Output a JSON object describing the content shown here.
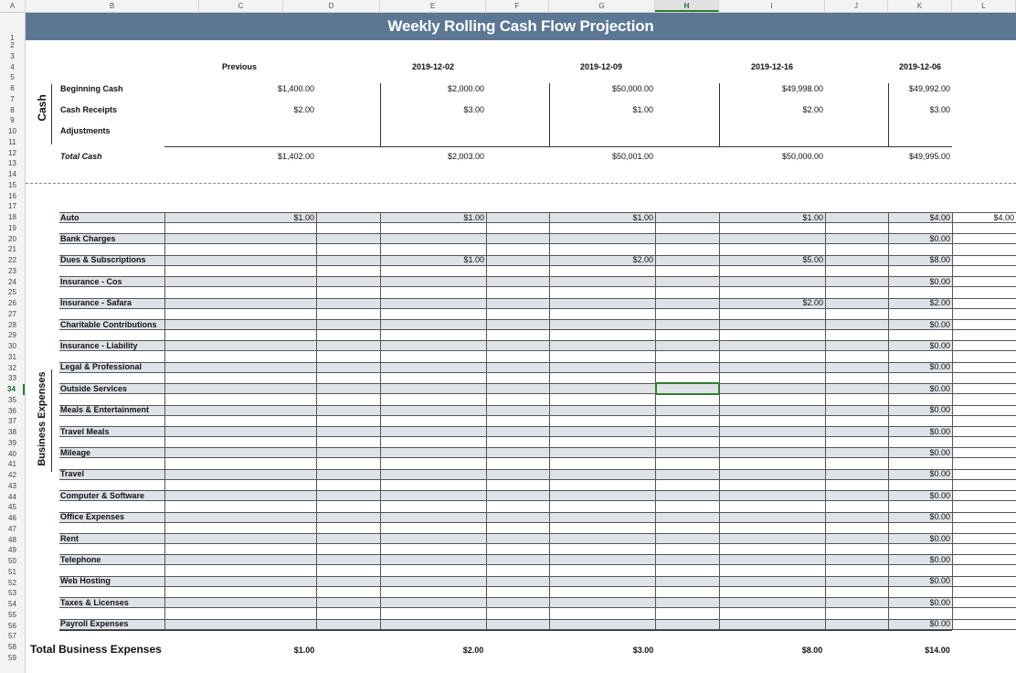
{
  "columns": [
    "A",
    "B",
    "C",
    "D",
    "E",
    "F",
    "G",
    "H",
    "I",
    "J",
    "K",
    "L"
  ],
  "selected_column": "H",
  "selected_row": "34",
  "title": "Weekly Rolling Cash Flow Projection",
  "period_headers": [
    "Previous",
    "2019-12-02",
    "2019-12-09",
    "2019-12-16",
    "2019-12-06"
  ],
  "cash_section_label": "Cash",
  "cash_rows": [
    {
      "label": "Beginning Cash",
      "values": [
        "$1,400.00",
        "$2,000.00",
        "$50,000.00",
        "$49,998.00",
        "$49,992.00"
      ]
    },
    {
      "label": "Cash Receipts",
      "values": [
        "$2.00",
        "$3.00",
        "$1.00",
        "$2.00",
        "$3.00"
      ]
    },
    {
      "label": "Adjustments",
      "values": [
        "",
        "",
        "",
        "",
        ""
      ]
    }
  ],
  "total_cash": {
    "label": "Total Cash",
    "values": [
      "$1,402.00",
      "$2,003.00",
      "$50,001.00",
      "$50,000.00",
      "$49,995.00"
    ]
  },
  "expenses_section_label": "Business Expenses",
  "expense_rows": [
    {
      "label": "Auto",
      "values": [
        "$1.00",
        "$1.00",
        "$1.00",
        "$1.00"
      ],
      "total": "$4.00",
      "extra": "$4.00"
    },
    {
      "label": "Bank Charges",
      "values": [
        "",
        "",
        "",
        ""
      ],
      "total": "$0.00",
      "extra": ""
    },
    {
      "label": "Dues & Subscriptions",
      "values": [
        "",
        "$1.00",
        "$2.00",
        "$5.00"
      ],
      "total": "$8.00",
      "extra": ""
    },
    {
      "label": "Insurance - Cos",
      "values": [
        "",
        "",
        "",
        ""
      ],
      "total": "$0.00",
      "extra": ""
    },
    {
      "label": "Insurance - Safara",
      "values": [
        "",
        "",
        "",
        "$2.00"
      ],
      "total": "$2.00",
      "extra": ""
    },
    {
      "label": "Charitable Contributions",
      "values": [
        "",
        "",
        "",
        ""
      ],
      "total": "$0.00",
      "extra": ""
    },
    {
      "label": "Insurance - Liability",
      "values": [
        "",
        "",
        "",
        ""
      ],
      "total": "$0.00",
      "extra": ""
    },
    {
      "label": "Legal & Professional",
      "values": [
        "",
        "",
        "",
        ""
      ],
      "total": "$0.00",
      "extra": ""
    },
    {
      "label": "Outside Services",
      "values": [
        "",
        "",
        "",
        ""
      ],
      "total": "$0.00",
      "extra": ""
    },
    {
      "label": "Meals & Entertainment",
      "values": [
        "",
        "",
        "",
        ""
      ],
      "total": "$0.00",
      "extra": ""
    },
    {
      "label": "Travel Meals",
      "values": [
        "",
        "",
        "",
        ""
      ],
      "total": "$0.00",
      "extra": ""
    },
    {
      "label": "Mileage",
      "values": [
        "",
        "",
        "",
        ""
      ],
      "total": "$0.00",
      "extra": ""
    },
    {
      "label": "Travel",
      "values": [
        "",
        "",
        "",
        ""
      ],
      "total": "$0.00",
      "extra": ""
    },
    {
      "label": "Computer & Software",
      "values": [
        "",
        "",
        "",
        ""
      ],
      "total": "$0.00",
      "extra": ""
    },
    {
      "label": "Office Expenses",
      "values": [
        "",
        "",
        "",
        ""
      ],
      "total": "$0.00",
      "extra": ""
    },
    {
      "label": "Rent",
      "values": [
        "",
        "",
        "",
        ""
      ],
      "total": "$0.00",
      "extra": ""
    },
    {
      "label": "Telephone",
      "values": [
        "",
        "",
        "",
        ""
      ],
      "total": "$0.00",
      "extra": ""
    },
    {
      "label": "Web Hosting",
      "values": [
        "",
        "",
        "",
        ""
      ],
      "total": "$0.00",
      "extra": ""
    },
    {
      "label": "Taxes & Licenses",
      "values": [
        "",
        "",
        "",
        ""
      ],
      "total": "$0.00",
      "extra": ""
    },
    {
      "label": "Payroll Expenses",
      "values": [
        "",
        "",
        "",
        ""
      ],
      "total": "$0.00",
      "extra": ""
    }
  ],
  "total_expenses": {
    "label": "Total Business Expenses",
    "values": [
      "$1.00",
      "$2.00",
      "$3.00",
      "$8.00",
      "$14.00"
    ]
  },
  "colors": {
    "title_band": "#5b7794",
    "row_band": "#dfe3e8",
    "selection": "#2e7d32"
  }
}
